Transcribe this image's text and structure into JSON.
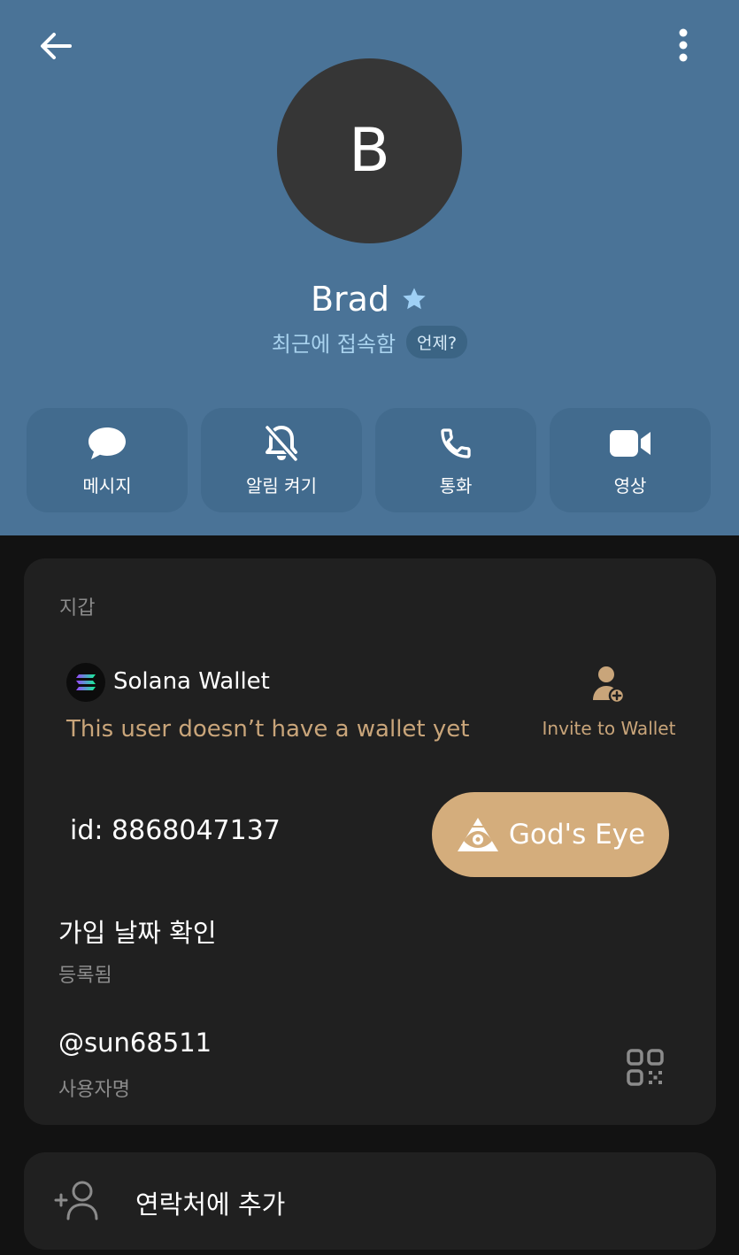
{
  "header": {
    "avatar_letter": "B",
    "name": "Brad",
    "status": "최근에 접속함",
    "when_label": "언제?"
  },
  "actions": [
    {
      "label": "메시지",
      "icon": "chat-bubble-icon"
    },
    {
      "label": "알림 켜기",
      "icon": "bell-off-icon"
    },
    {
      "label": "통화",
      "icon": "phone-icon"
    },
    {
      "label": "영상",
      "icon": "video-camera-icon"
    }
  ],
  "info_card": {
    "section_title": "지갑",
    "wallet": {
      "name": "Solana Wallet",
      "message": "This user doesn’t have a wallet yet",
      "invite_label": "Invite to Wallet"
    },
    "id_text": "id: 8868047137",
    "gods_eye_label": "God's Eye",
    "join_title": "가입 날짜 확인",
    "join_sub": "등록됨",
    "username": "@sun68511",
    "username_sub": "사용자명"
  },
  "add_contact_label": "연락처에 추가",
  "colors": {
    "header_bg": "#4a7397",
    "action_bg": "#426b8e",
    "card_bg": "#202020",
    "page_bg": "#121212",
    "gold_accent": "#c9a57a",
    "gods_eye_bg": "#d4ad7c",
    "status_blue": "#a8d2ee",
    "star_blue": "#9fd0f5"
  }
}
